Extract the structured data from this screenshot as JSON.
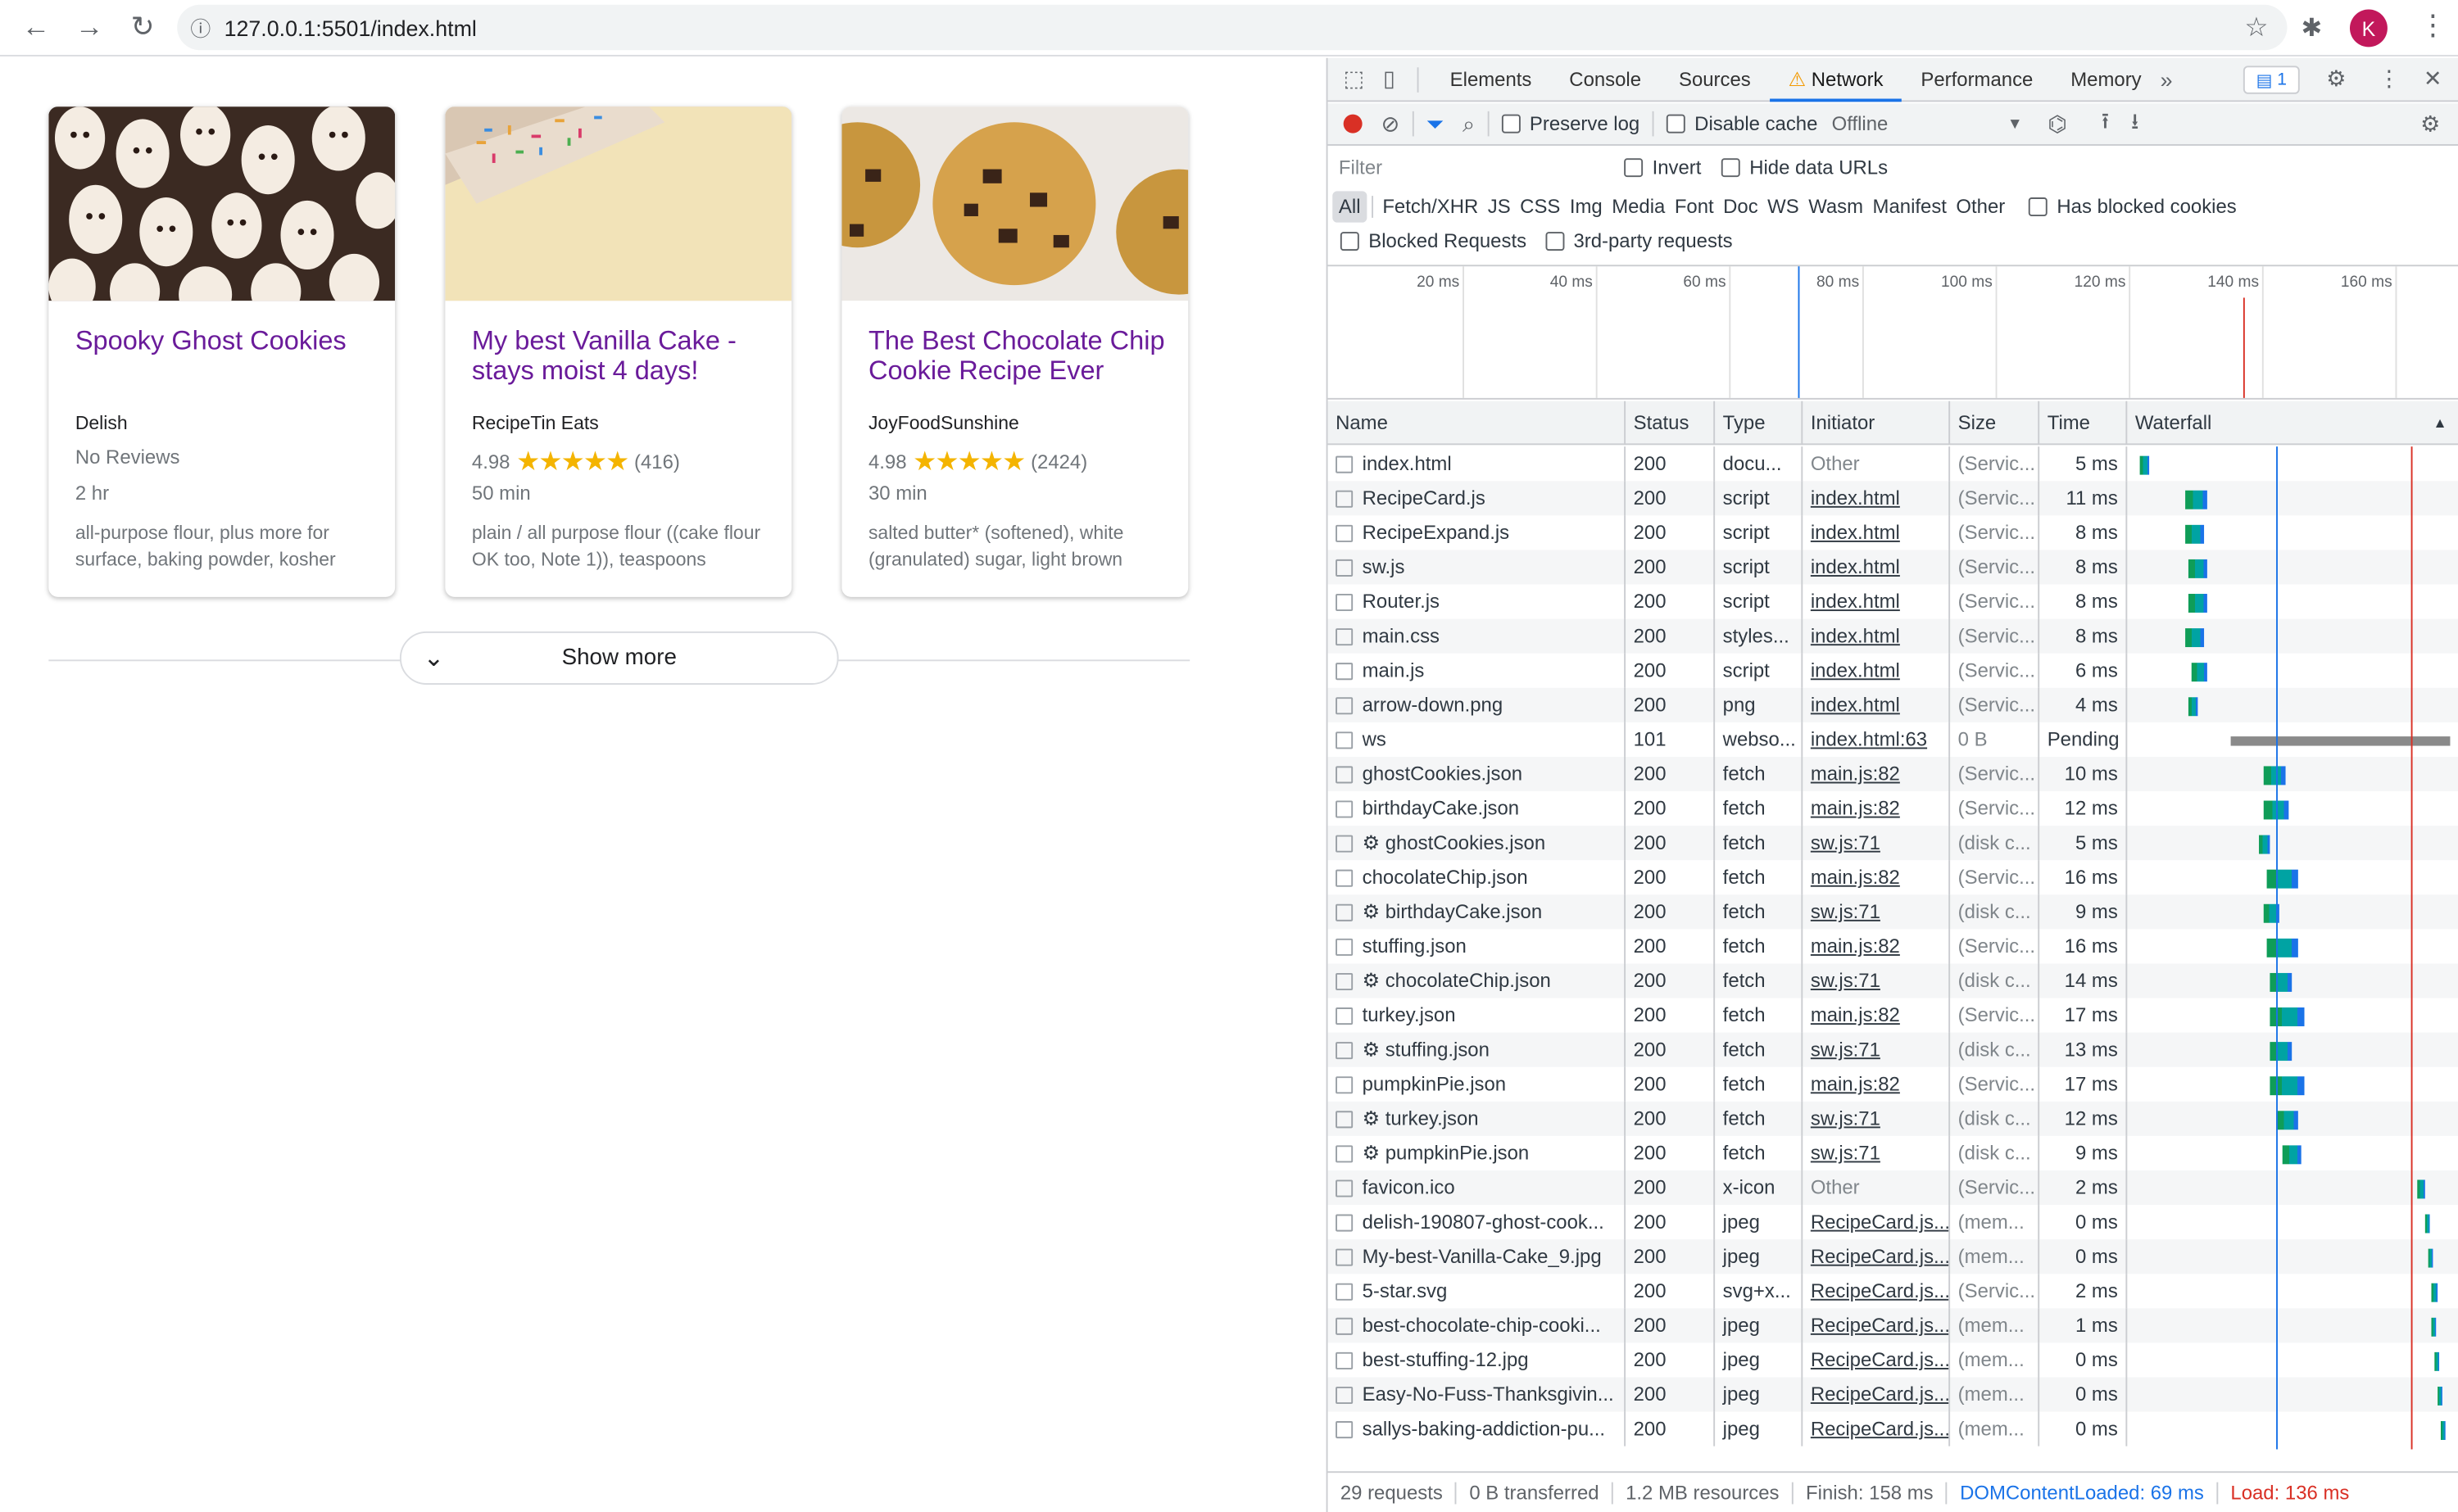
{
  "browser": {
    "url": "127.0.0.1:5501/index.html",
    "avatar_letter": "K"
  },
  "cards": [
    {
      "title": "Spooky Ghost Cookies",
      "source": "Delish",
      "rating": "",
      "reviews": "",
      "no_reviews": "No Reviews",
      "time": "2 hr",
      "ingredients": "all-purpose flour, plus more for surface, baking powder, kosher"
    },
    {
      "title": "My best Vanilla Cake - stays moist 4 days!",
      "source": "RecipeTin Eats",
      "rating": "4.98",
      "reviews": "(416)",
      "no_reviews": "",
      "time": "50 min",
      "ingredients": "plain / all purpose flour ((cake flour OK too, Note 1)), teaspoons"
    },
    {
      "title": "The Best Chocolate Chip Cookie Recipe Ever",
      "source": "JoyFoodSunshine",
      "rating": "4.98",
      "reviews": "(2424)",
      "no_reviews": "",
      "time": "30 min",
      "ingredients": "salted butter* (softened), white (granulated) sugar, light brown"
    }
  ],
  "show_more": "Show more",
  "devtools": {
    "tabs": [
      "Elements",
      "Console",
      "Sources",
      "Network",
      "Performance",
      "Memory"
    ],
    "active_tab": "Network",
    "issues_count": "1",
    "toolbar": {
      "preserve_log": "Preserve log",
      "disable_cache": "Disable cache",
      "throttle": "Offline"
    },
    "filter_placeholder": "Filter",
    "invert": "Invert",
    "hide_data_urls": "Hide data URLs",
    "types": [
      "All",
      "Fetch/XHR",
      "JS",
      "CSS",
      "Img",
      "Media",
      "Font",
      "Doc",
      "WS",
      "Wasm",
      "Manifest",
      "Other"
    ],
    "has_blocked_cookies": "Has blocked cookies",
    "blocked_requests": "Blocked Requests",
    "third_party": "3rd-party requests",
    "timeline_ticks": [
      "20 ms",
      "40 ms",
      "60 ms",
      "80 ms",
      "100 ms",
      "120 ms",
      "140 ms",
      "160 ms"
    ],
    "columns": [
      "Name",
      "Status",
      "Type",
      "Initiator",
      "Size",
      "Time",
      "Waterfall"
    ],
    "rows": [
      {
        "name": "index.html",
        "status": "200",
        "type": "docu...",
        "initiator": "Other",
        "init_link": false,
        "size": "(Servic...",
        "time": "5 ms"
      },
      {
        "name": "RecipeCard.js",
        "status": "200",
        "type": "script",
        "initiator": "index.html",
        "init_link": true,
        "size": "(Servic...",
        "time": "11 ms"
      },
      {
        "name": "RecipeExpand.js",
        "status": "200",
        "type": "script",
        "initiator": "index.html",
        "init_link": true,
        "size": "(Servic...",
        "time": "8 ms"
      },
      {
        "name": "sw.js",
        "status": "200",
        "type": "script",
        "initiator": "index.html",
        "init_link": true,
        "size": "(Servic...",
        "time": "8 ms"
      },
      {
        "name": "Router.js",
        "status": "200",
        "type": "script",
        "initiator": "index.html",
        "init_link": true,
        "size": "(Servic...",
        "time": "8 ms"
      },
      {
        "name": "main.css",
        "status": "200",
        "type": "styles...",
        "initiator": "index.html",
        "init_link": true,
        "size": "(Servic...",
        "time": "8 ms"
      },
      {
        "name": "main.js",
        "status": "200",
        "type": "script",
        "initiator": "index.html",
        "init_link": true,
        "size": "(Servic...",
        "time": "6 ms"
      },
      {
        "name": "arrow-down.png",
        "status": "200",
        "type": "png",
        "initiator": "index.html",
        "init_link": true,
        "size": "(Servic...",
        "time": "4 ms"
      },
      {
        "name": "ws",
        "status": "101",
        "type": "webso...",
        "initiator": "index.html:63",
        "init_link": true,
        "size": "0 B",
        "time": "Pending"
      },
      {
        "name": "ghostCookies.json",
        "status": "200",
        "type": "fetch",
        "initiator": "main.js:82",
        "init_link": true,
        "size": "(Servic...",
        "time": "10 ms"
      },
      {
        "name": "birthdayCake.json",
        "status": "200",
        "type": "fetch",
        "initiator": "main.js:82",
        "init_link": true,
        "size": "(Servic...",
        "time": "12 ms"
      },
      {
        "name": "⚙ ghostCookies.json",
        "status": "200",
        "type": "fetch",
        "initiator": "sw.js:71",
        "init_link": true,
        "size": "(disk c...",
        "time": "5 ms"
      },
      {
        "name": "chocolateChip.json",
        "status": "200",
        "type": "fetch",
        "initiator": "main.js:82",
        "init_link": true,
        "size": "(Servic...",
        "time": "16 ms"
      },
      {
        "name": "⚙ birthdayCake.json",
        "status": "200",
        "type": "fetch",
        "initiator": "sw.js:71",
        "init_link": true,
        "size": "(disk c...",
        "time": "9 ms"
      },
      {
        "name": "stuffing.json",
        "status": "200",
        "type": "fetch",
        "initiator": "main.js:82",
        "init_link": true,
        "size": "(Servic...",
        "time": "16 ms"
      },
      {
        "name": "⚙ chocolateChip.json",
        "status": "200",
        "type": "fetch",
        "initiator": "sw.js:71",
        "init_link": true,
        "size": "(disk c...",
        "time": "14 ms"
      },
      {
        "name": "turkey.json",
        "status": "200",
        "type": "fetch",
        "initiator": "main.js:82",
        "init_link": true,
        "size": "(Servic...",
        "time": "17 ms"
      },
      {
        "name": "⚙ stuffing.json",
        "status": "200",
        "type": "fetch",
        "initiator": "sw.js:71",
        "init_link": true,
        "size": "(disk c...",
        "time": "13 ms"
      },
      {
        "name": "pumpkinPie.json",
        "status": "200",
        "type": "fetch",
        "initiator": "main.js:82",
        "init_link": true,
        "size": "(Servic...",
        "time": "17 ms"
      },
      {
        "name": "⚙ turkey.json",
        "status": "200",
        "type": "fetch",
        "initiator": "sw.js:71",
        "init_link": true,
        "size": "(disk c...",
        "time": "12 ms"
      },
      {
        "name": "⚙ pumpkinPie.json",
        "status": "200",
        "type": "fetch",
        "initiator": "sw.js:71",
        "init_link": true,
        "size": "(disk c...",
        "time": "9 ms"
      },
      {
        "name": "favicon.ico",
        "status": "200",
        "type": "x-icon",
        "initiator": "Other",
        "init_link": false,
        "size": "(Servic...",
        "time": "2 ms"
      },
      {
        "name": "delish-190807-ghost-cook...",
        "status": "200",
        "type": "jpeg",
        "initiator": "RecipeCard.js...",
        "init_link": true,
        "size": "(mem...",
        "time": "0 ms"
      },
      {
        "name": "My-best-Vanilla-Cake_9.jpg",
        "status": "200",
        "type": "jpeg",
        "initiator": "RecipeCard.js...",
        "init_link": true,
        "size": "(mem...",
        "time": "0 ms"
      },
      {
        "name": "5-star.svg",
        "status": "200",
        "type": "svg+x...",
        "initiator": "RecipeCard.js...",
        "init_link": true,
        "size": "(Servic...",
        "time": "2 ms"
      },
      {
        "name": "best-chocolate-chip-cooki...",
        "status": "200",
        "type": "jpeg",
        "initiator": "RecipeCard.js...",
        "init_link": true,
        "size": "(mem...",
        "time": "1 ms"
      },
      {
        "name": "best-stuffing-12.jpg",
        "status": "200",
        "type": "jpeg",
        "initiator": "RecipeCard.js...",
        "init_link": true,
        "size": "(mem...",
        "time": "0 ms"
      },
      {
        "name": "Easy-No-Fuss-Thanksgivin...",
        "status": "200",
        "type": "jpeg",
        "initiator": "RecipeCard.js...",
        "init_link": true,
        "size": "(mem...",
        "time": "0 ms"
      },
      {
        "name": "sallys-baking-addiction-pu...",
        "status": "200",
        "type": "jpeg",
        "initiator": "RecipeCard.js...",
        "init_link": true,
        "size": "(mem...",
        "time": "0 ms"
      }
    ],
    "status_bar": {
      "requests": "29 requests",
      "transferred": "0 B transferred",
      "resources": "1.2 MB resources",
      "finish": "Finish: 158 ms",
      "dcl": "DOMContentLoaded: 69 ms",
      "load": "Load: 136 ms"
    },
    "colors": {
      "accent": "#1a73e8",
      "load": "#d93025",
      "dcl": "#1a73e8",
      "bar_teal": "#00a3a3",
      "bar_blue": "#1a73e8",
      "bar_green": "#0f9d58"
    }
  }
}
